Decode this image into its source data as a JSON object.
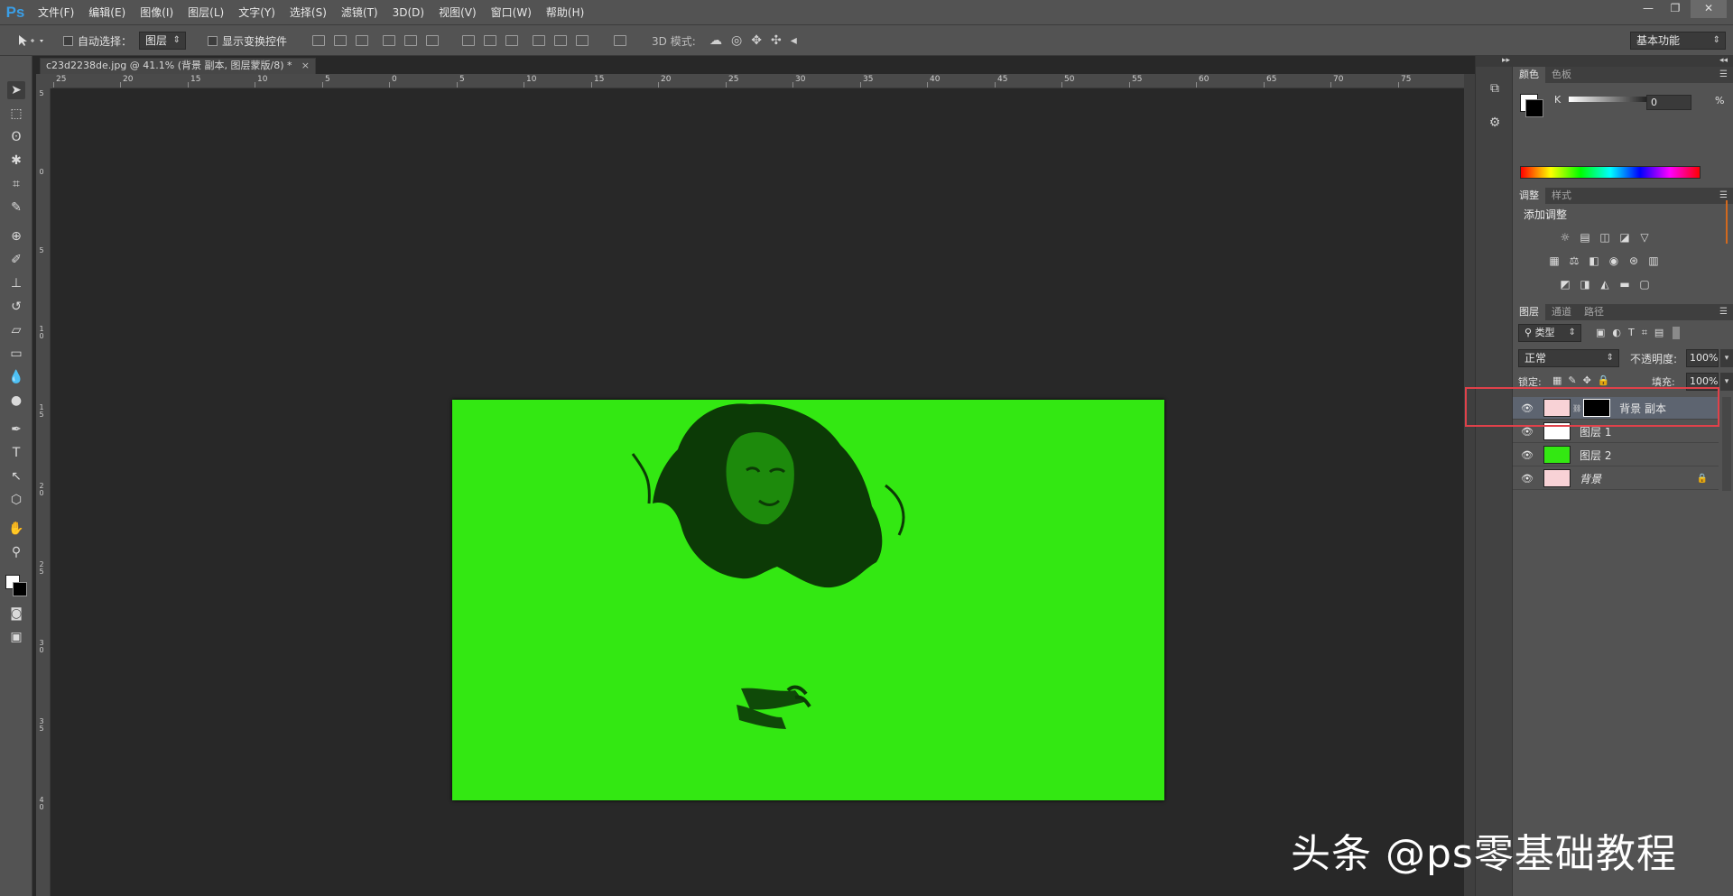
{
  "app": {
    "logo": "Ps",
    "menu": [
      "文件(F)",
      "编辑(E)",
      "图像(I)",
      "图层(L)",
      "文字(Y)",
      "选择(S)",
      "滤镜(T)",
      "3D(D)",
      "视图(V)",
      "窗口(W)",
      "帮助(H)"
    ],
    "window_controls": [
      "—",
      "❐",
      "✕"
    ]
  },
  "options": {
    "auto_select_label": "自动选择：",
    "auto_select_value": "图层",
    "show_transform_label": "显示变换控件",
    "mode_3d_label": "3D 模式:",
    "workspace": "基本功能"
  },
  "document": {
    "tab_title": "c23d2238de.jpg @ 41.1% (背景 副本, 图层蒙版/8) *",
    "tab_close": "×",
    "canvas_color": "#33e812"
  },
  "rulers": {
    "top_labels": [
      "25",
      "20",
      "15",
      "10",
      "5",
      "0",
      "5",
      "10",
      "15",
      "20",
      "25",
      "30",
      "35",
      "40",
      "45",
      "50",
      "55",
      "60",
      "65",
      "70",
      "75"
    ],
    "left_labels": [
      "5",
      "0",
      "5",
      "1\n0",
      "1\n5",
      "2\n0",
      "2\n5",
      "3\n0",
      "3\n5",
      "4\n0"
    ]
  },
  "panels": {
    "color_tabs": [
      "颜色",
      "色板"
    ],
    "color_channel": "K",
    "color_value": "0",
    "color_unit": "%",
    "adjust_tabs": [
      "调整",
      "样式"
    ],
    "adjust_title": "添加调整",
    "layers_tabs": [
      "图层",
      "通道",
      "路径"
    ],
    "filter_type": "类型",
    "blend_mode": "正常",
    "opacity_label": "不透明度:",
    "opacity_value": "100%",
    "lock_label": "锁定:",
    "fill_label": "填充:",
    "fill_value": "100%",
    "layers": [
      {
        "name": "背景 副本",
        "selected": true
      },
      {
        "name": "图层 1",
        "selected": false
      },
      {
        "name": "图层 2",
        "selected": false
      },
      {
        "name": "背景",
        "selected": false
      }
    ]
  },
  "watermark": "头条 @ps零基础教程",
  "colors": {
    "accent_red": "#e0414a",
    "canvas_green": "#33e812",
    "ps_blue": "#3a9ee6"
  }
}
